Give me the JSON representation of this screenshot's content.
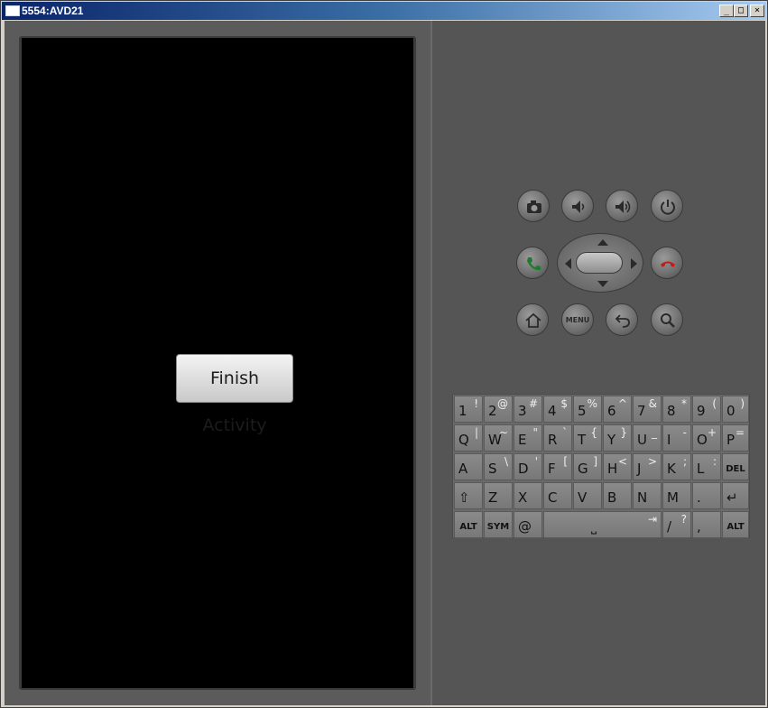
{
  "window": {
    "title": "5554:AVD21",
    "buttons": {
      "minimize": "_",
      "maximize": "□",
      "close": "×"
    }
  },
  "app": {
    "finish_button_label": "Finish Activity"
  },
  "controls": {
    "camera": "camera-icon",
    "volume_down": "volume-down-icon",
    "volume_up": "volume-up-icon",
    "power": "power-icon",
    "call": "call-icon",
    "end_call": "end-call-icon",
    "home": "home-icon",
    "menu_label": "MENU",
    "back": "back-icon",
    "search": "search-icon"
  },
  "keyboard": {
    "row1": [
      {
        "main": "1",
        "alt": "!"
      },
      {
        "main": "2",
        "alt": "@"
      },
      {
        "main": "3",
        "alt": "#"
      },
      {
        "main": "4",
        "alt": "$"
      },
      {
        "main": "5",
        "alt": "%"
      },
      {
        "main": "6",
        "alt": "^"
      },
      {
        "main": "7",
        "alt": "&"
      },
      {
        "main": "8",
        "alt": "*"
      },
      {
        "main": "9",
        "alt": "("
      },
      {
        "main": "0",
        "alt": ")"
      }
    ],
    "row2": [
      {
        "main": "Q",
        "alt": "|"
      },
      {
        "main": "W",
        "alt": "~"
      },
      {
        "main": "E",
        "alt": "\""
      },
      {
        "main": "R",
        "alt": "`"
      },
      {
        "main": "T",
        "alt": "{"
      },
      {
        "main": "Y",
        "alt": "}"
      },
      {
        "main": "U",
        "alt": "_"
      },
      {
        "main": "I",
        "alt": "-"
      },
      {
        "main": "O",
        "alt": "+"
      },
      {
        "main": "P",
        "alt": "="
      }
    ],
    "row3": [
      {
        "main": "A",
        "alt": ""
      },
      {
        "main": "S",
        "alt": "\\"
      },
      {
        "main": "D",
        "alt": "'"
      },
      {
        "main": "F",
        "alt": "["
      },
      {
        "main": "G",
        "alt": "]"
      },
      {
        "main": "H",
        "alt": "<"
      },
      {
        "main": "J",
        "alt": ">"
      },
      {
        "main": "K",
        "alt": ";"
      },
      {
        "main": "L",
        "alt": ":"
      },
      {
        "main": "DEL",
        "alt": ""
      }
    ],
    "row4": [
      {
        "main": "⇧",
        "alt": ""
      },
      {
        "main": "Z",
        "alt": ""
      },
      {
        "main": "X",
        "alt": ""
      },
      {
        "main": "C",
        "alt": ""
      },
      {
        "main": "V",
        "alt": ""
      },
      {
        "main": "B",
        "alt": ""
      },
      {
        "main": "N",
        "alt": ""
      },
      {
        "main": "M",
        "alt": ""
      },
      {
        "main": ".",
        "alt": ""
      },
      {
        "main": "↵",
        "alt": ""
      }
    ],
    "row5": {
      "alt_left": "ALT",
      "sym": "SYM",
      "at": "@",
      "space": "⎵",
      "tab": "⇥",
      "slash": "/",
      "slash_alt": "?",
      "comma": ",",
      "alt_right": "ALT"
    }
  }
}
